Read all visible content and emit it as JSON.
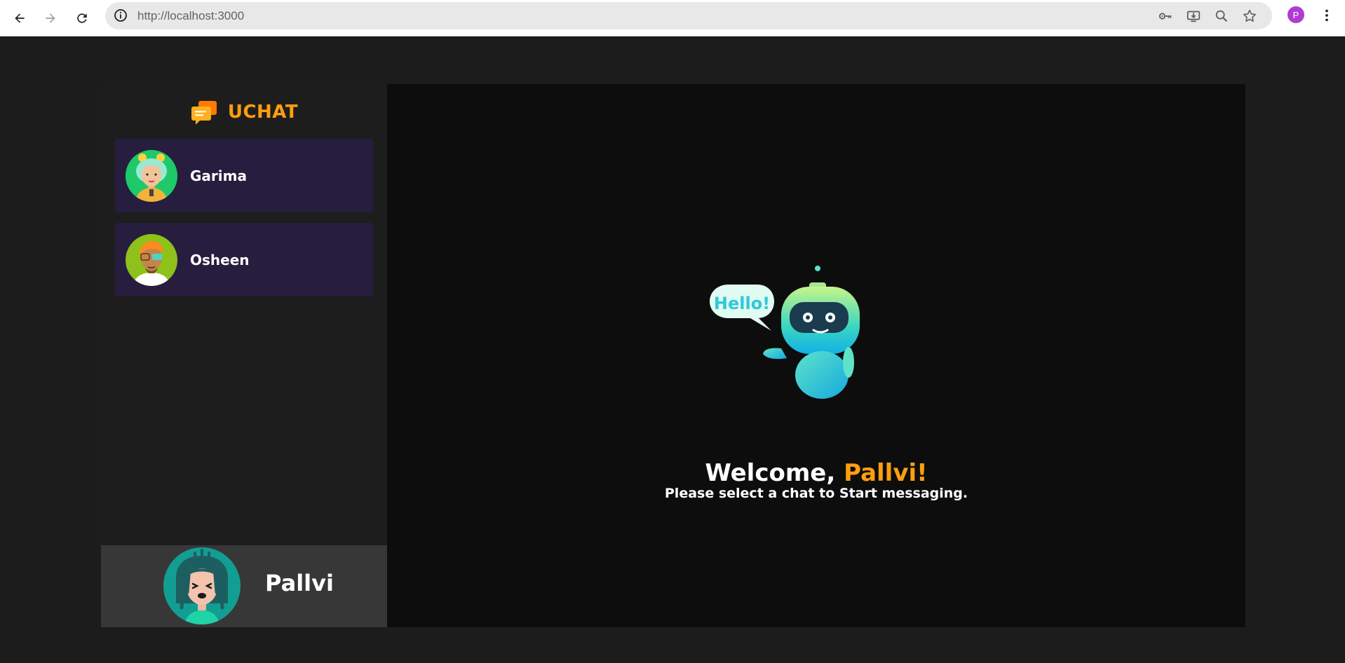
{
  "browser": {
    "url": "http://localhost:3000",
    "profile_initial": "P",
    "icons": [
      "back-icon",
      "forward-icon",
      "reload-icon",
      "info-icon",
      "key-icon",
      "install-icon",
      "zoom-icon",
      "star-icon",
      "kebab-menu-icon"
    ]
  },
  "sidebar": {
    "brand": "UCHAT",
    "contacts": [
      {
        "name": "Garima",
        "avatar": "girl-avatar"
      },
      {
        "name": "Osheen",
        "avatar": "boy-avatar"
      }
    ],
    "current_user": {
      "name": "Pallvi",
      "avatar": "dreadlocks-avatar"
    }
  },
  "main": {
    "welcome_prefix": "Welcome, ",
    "welcome_name": "Pallvi!",
    "subtitle": "Please select a chat to Start messaging.",
    "bubble_text": "Hello!"
  },
  "colors": {
    "accent": "#ff9e0f",
    "contact_bg": "#271d3f",
    "sidebar_bg": "#1d1d1d",
    "main_bg": "#0d0d0d",
    "user_panel_bg": "#373737"
  }
}
